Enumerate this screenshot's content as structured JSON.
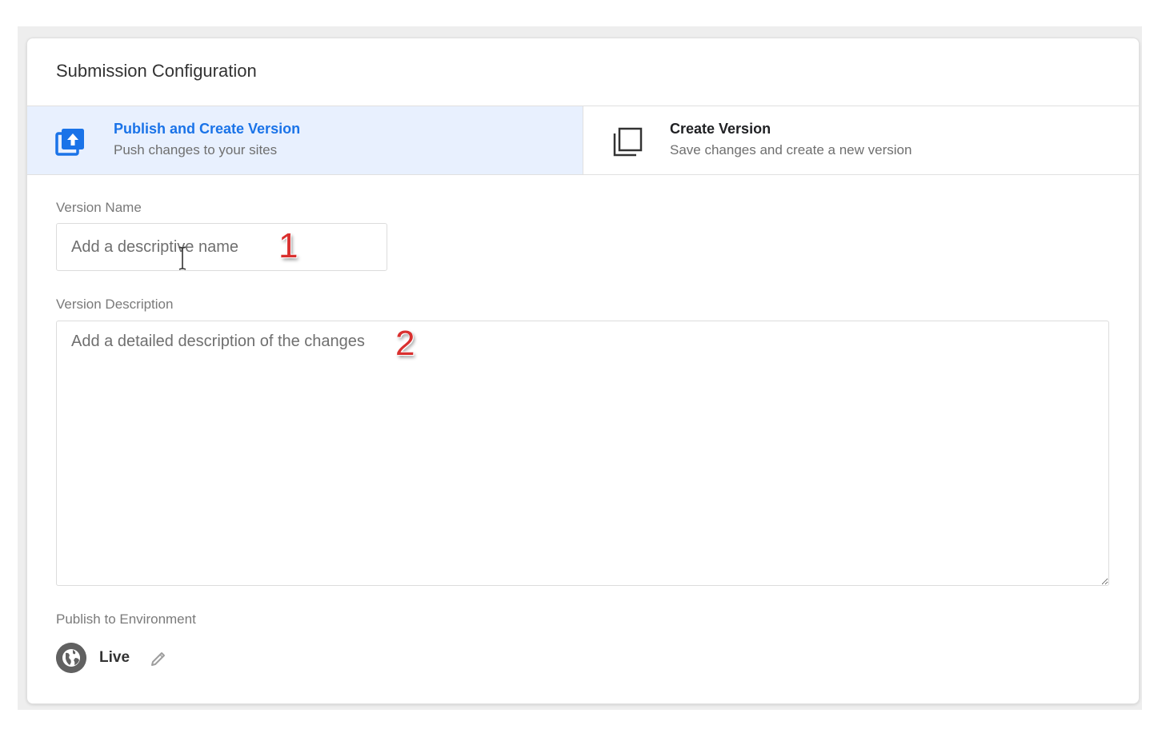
{
  "card": {
    "title": "Submission Configuration"
  },
  "options": [
    {
      "title": "Publish and Create Version",
      "subtitle": "Push changes to your sites",
      "selected": true,
      "icon": "publish-upload-icon"
    },
    {
      "title": "Create Version",
      "subtitle": "Save changes and create a new version",
      "selected": false,
      "icon": "copy-version-icon"
    }
  ],
  "version_name": {
    "label": "Version Name",
    "placeholder": "Add a descriptive name",
    "value": ""
  },
  "version_description": {
    "label": "Version Description",
    "placeholder": "Add a detailed description of the changes",
    "value": ""
  },
  "annotations": {
    "step1": "1",
    "step2": "2"
  },
  "environment": {
    "label": "Publish to Environment",
    "name": "Live",
    "icon": "globe-icon",
    "edit_icon": "pencil-icon"
  },
  "colors": {
    "accent": "#1a73e8",
    "selected_bg": "#e8f0fe",
    "annotation": "#d9302f"
  }
}
